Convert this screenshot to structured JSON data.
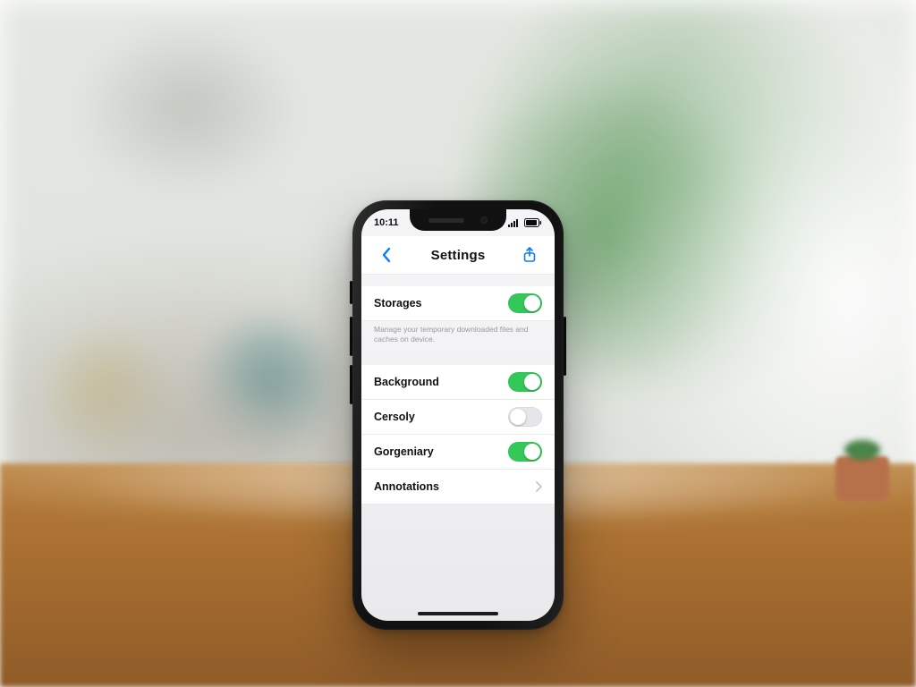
{
  "statusbar": {
    "time": "10:11"
  },
  "navbar": {
    "title": "Settings"
  },
  "rows": [
    {
      "label": "Storages",
      "toggle": true,
      "footer": "Manage your temporary downloaded files and caches on device."
    },
    {
      "label": "Background",
      "toggle": true
    },
    {
      "label": "Cersoly",
      "toggle": false
    },
    {
      "label": "Gorgeniary",
      "toggle": true
    },
    {
      "label": "Annotations"
    }
  ]
}
